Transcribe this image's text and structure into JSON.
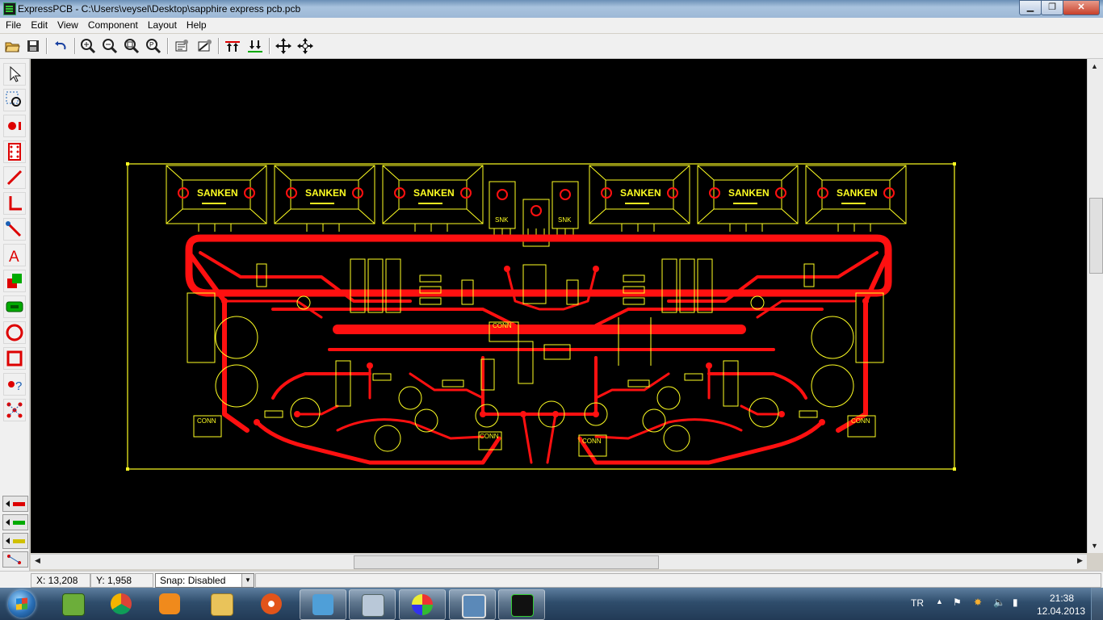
{
  "window": {
    "title": "ExpressPCB - C:\\Users\\veysel\\Desktop\\sapphire express pcb.pcb",
    "minimize": "▁",
    "maximize": "❐",
    "close": "✕"
  },
  "menu": [
    "File",
    "Edit",
    "View",
    "Component",
    "Layout",
    "Help"
  ],
  "toolbar": {
    "icons": [
      "open-icon",
      "save-icon",
      "undo-icon",
      "zoom-in-icon",
      "zoom-out-icon",
      "zoom-fit-icon",
      "zoom-previous-icon",
      "component-properties-icon",
      "trace-properties-icon",
      "top-layer-icon",
      "bottom-layer-icon",
      "move-icon",
      "rotate-icon"
    ]
  },
  "tools": {
    "icons": [
      "select-icon",
      "zoom-select-icon",
      "place-pad-icon",
      "place-component-icon",
      "trace-icon",
      "trace-corner-icon",
      "trace-end-icon",
      "text-icon",
      "filled-shape-icon",
      "ground-plane-icon",
      "circle-icon",
      "rectangle-icon",
      "help-icon",
      "netlist-icon"
    ],
    "layers": [
      "top-layer-icon",
      "bottom-layer-icon",
      "silkscreen-layer-icon",
      "ratsnest-icon"
    ]
  },
  "board": {
    "colors": {
      "background": "#000000",
      "copper": "#ff1010",
      "silk": "#ffff22"
    },
    "sanken_label": "SANKEN",
    "snk_label": "SNK",
    "conn_label": "CONN"
  },
  "status": {
    "x": "X: 13,208",
    "y": "Y: 1,958",
    "snap": "Snap:  Disabled"
  },
  "taskbar": {
    "lang": "TR",
    "time": "21:38",
    "date": "12.04.2013"
  }
}
